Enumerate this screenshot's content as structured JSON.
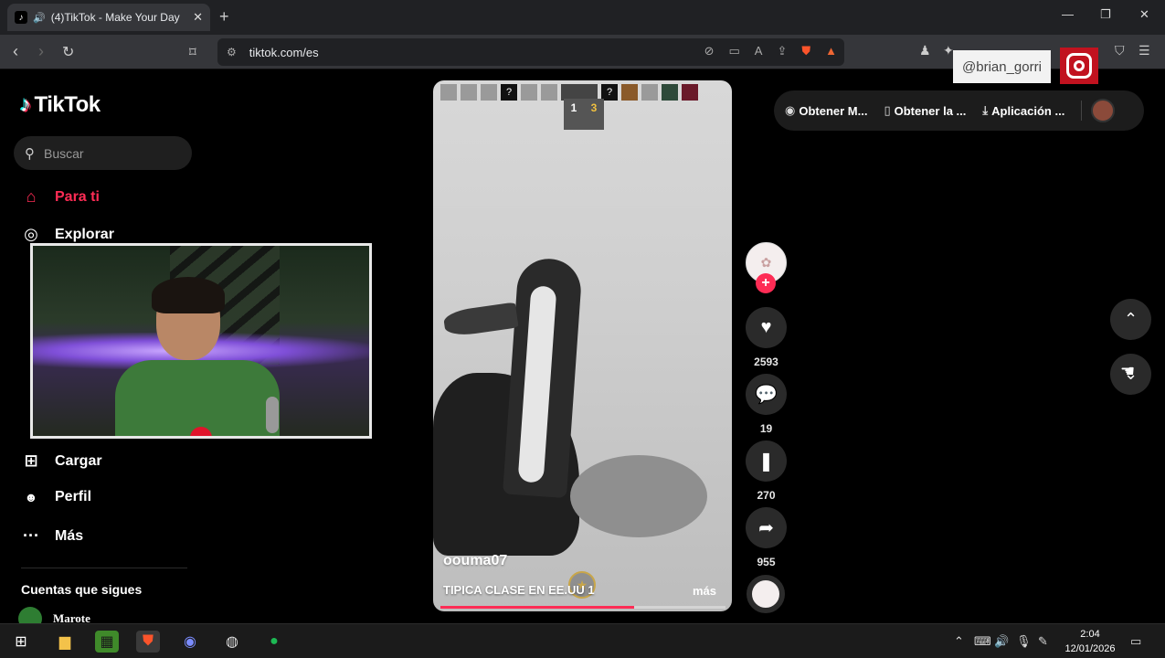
{
  "browser": {
    "tab_title": "(4)TikTok - Make Your Day",
    "url": "tiktok.com/es",
    "new_tab_symbol": "+",
    "close_tab_symbol": "✕"
  },
  "overlay": {
    "instagram_handle": "@brian_gorri"
  },
  "app": {
    "logo_text": "TikTok",
    "search_placeholder": "Buscar"
  },
  "sidebar": {
    "items": [
      {
        "label": "Para ti",
        "icon": "home-icon"
      },
      {
        "label": "Explorar",
        "icon": "compass-icon"
      },
      {
        "label": "Cargar",
        "icon": "upload-icon"
      },
      {
        "label": "Perfil",
        "icon": "profile-icon"
      },
      {
        "label": "Más",
        "icon": "more-icon"
      }
    ],
    "following_title": "Cuentas que sigues",
    "accounts": [
      {
        "name": "Marote"
      }
    ]
  },
  "video": {
    "username": "oouma07",
    "caption": "TIPICA CLASE EN EE.UU 1",
    "more_label": "más",
    "game_score": [
      "1",
      "3"
    ],
    "progress": 0.68
  },
  "actions": {
    "likes": "2593",
    "comments": "19",
    "saves": "270",
    "shares": "955"
  },
  "topbar": {
    "items": [
      "Obtener M...",
      "Obtener la ...",
      "Aplicación ..."
    ]
  },
  "taskbar": {
    "time": "2:04",
    "date": "12/01/2026"
  },
  "colors": {
    "accent": "#fe2c55",
    "background": "#000000"
  }
}
